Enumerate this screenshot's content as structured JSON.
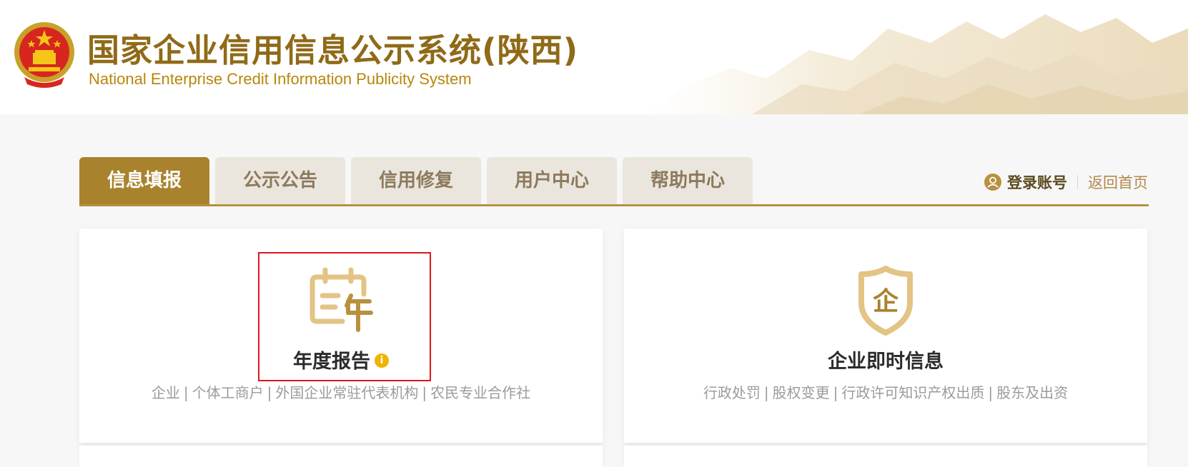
{
  "header": {
    "title": "国家企业信用信息公示系统(陕西)",
    "subtitle": "National Enterprise Credit Information Publicity System",
    "emblem_icon": "national-emblem-icon"
  },
  "tabs": [
    {
      "label": "信息填报",
      "active": true
    },
    {
      "label": "公示公告",
      "active": false
    },
    {
      "label": "信用修复",
      "active": false
    },
    {
      "label": "用户中心",
      "active": false
    },
    {
      "label": "帮助中心",
      "active": false
    }
  ],
  "user_bar": {
    "login_label": "登录账号",
    "home_label": "返回首页",
    "user_icon": "user-avatar-icon"
  },
  "cards": [
    {
      "title": "年度报告",
      "icon": "calendar-year-icon",
      "info_icon": "info-icon",
      "info_glyph": "i",
      "links": [
        "企业",
        "个体工商户",
        "外国企业常驻代表机构",
        "农民专业合作社"
      ],
      "pipe": "|"
    },
    {
      "title": "企业即时信息",
      "icon": "enterprise-shield-icon",
      "icon_glyph": "企",
      "links": [
        "行政处罚",
        "股权变更",
        "行政许可知识产权出质",
        "股东及出资"
      ],
      "pipe": "|"
    }
  ],
  "colors": {
    "brand_gold": "#a9822e",
    "title_gold": "#8f6a17",
    "tab_inactive_bg": "#ebe6dd",
    "info_badge": "#f0b400",
    "highlight_red": "#e0161b"
  }
}
